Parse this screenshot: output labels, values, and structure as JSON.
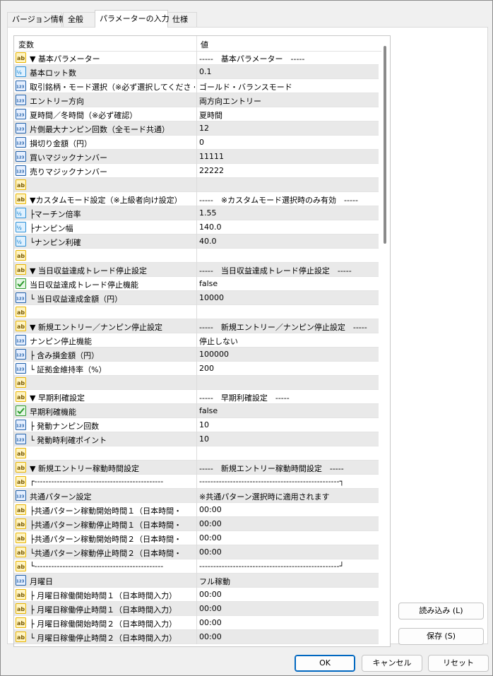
{
  "tabs": [
    {
      "label": "バージョン情報"
    },
    {
      "label": "全般"
    },
    {
      "label": "パラメーターの入力"
    },
    {
      "label": "仕様"
    }
  ],
  "grid": {
    "col_name": "変数",
    "col_value": "値",
    "rows": [
      {
        "icon": "ab",
        "name": "▼ 基本パラメーター",
        "value": "-----　基本パラメーター　-----"
      },
      {
        "icon": "v2",
        "name": "基本ロット数",
        "value": "0.1"
      },
      {
        "icon": "123",
        "name": "取引銘柄・モード選択（※必ず選択してくださ・",
        "value": "ゴールド・バランスモード"
      },
      {
        "icon": "123",
        "name": "エントリー方向",
        "value": "両方向エントリー"
      },
      {
        "icon": "123",
        "name": "夏時間／冬時間（※必ず確認）",
        "value": "夏時間"
      },
      {
        "icon": "123",
        "name": "片側最大ナンピン回数（全モード共通）",
        "value": "12"
      },
      {
        "icon": "123",
        "name": "損切り金額（円）",
        "value": "0"
      },
      {
        "icon": "123",
        "name": "買いマジックナンバー",
        "value": "11111"
      },
      {
        "icon": "123",
        "name": "売りマジックナンバー",
        "value": "22222"
      },
      {
        "icon": "ab",
        "name": "",
        "value": ""
      },
      {
        "icon": "ab",
        "name": "▼カスタムモード設定（※上級者向け設定）",
        "value": "-----　※カスタムモード選択時のみ有効　-----"
      },
      {
        "icon": "v2",
        "name": "├マーチン倍率",
        "value": "1.55"
      },
      {
        "icon": "v2",
        "name": "├ナンピン幅",
        "value": "140.0"
      },
      {
        "icon": "v2",
        "name": "└ナンピン利確",
        "value": "40.0"
      },
      {
        "icon": "ab",
        "name": "",
        "value": ""
      },
      {
        "icon": "ab",
        "name": "▼ 当日収益達成トレード停止設定",
        "value": "-----　当日収益達成トレード停止設定　-----"
      },
      {
        "icon": "bool",
        "name": "当日収益達成トレード停止機能",
        "value": "false"
      },
      {
        "icon": "123",
        "name": "└ 当日収益達成金額（円）",
        "value": "10000"
      },
      {
        "icon": "ab",
        "name": "",
        "value": ""
      },
      {
        "icon": "ab",
        "name": "▼ 新規エントリー／ナンピン停止設定",
        "value": "-----　新規エントリー／ナンピン停止設定　-----"
      },
      {
        "icon": "123",
        "name": "ナンピン停止機能",
        "value": "停止しない"
      },
      {
        "icon": "123",
        "name": "├ 含み損金額（円）",
        "value": "100000"
      },
      {
        "icon": "123",
        "name": "└ 証拠金維持率（%）",
        "value": "200"
      },
      {
        "icon": "ab",
        "name": "",
        "value": ""
      },
      {
        "icon": "ab",
        "name": "▼ 早期利確設定",
        "value": "-----　早期利確設定　-----"
      },
      {
        "icon": "bool",
        "name": "早期利確機能",
        "value": "false"
      },
      {
        "icon": "123",
        "name": "├ 発動ナンピン回数",
        "value": "10"
      },
      {
        "icon": "123",
        "name": "└ 発動時利確ポイント",
        "value": "10"
      },
      {
        "icon": "ab",
        "name": "",
        "value": ""
      },
      {
        "icon": "ab",
        "name": "▼ 新規エントリー稼動時間設定",
        "value": "-----　新規エントリー稼動時間設定　-----"
      },
      {
        "icon": "ab",
        "name": "┌----------------------------------------------",
        "value": "--------------------------------------------------┐"
      },
      {
        "icon": "123",
        "name": "共通パターン設定",
        "value": "※共通パターン選択時に適用されます"
      },
      {
        "icon": "ab",
        "name": "├共通パターン稼動開始時間１（日本時間・",
        "value": "00:00"
      },
      {
        "icon": "ab",
        "name": "├共通パターン稼動停止時間１（日本時間・",
        "value": "00:00"
      },
      {
        "icon": "ab",
        "name": "├共通パターン稼動開始時間２（日本時間・",
        "value": "00:00"
      },
      {
        "icon": "ab",
        "name": "└共通パターン稼動停止時間２（日本時間・",
        "value": "00:00"
      },
      {
        "icon": "ab",
        "name": "└----------------------------------------------",
        "value": "--------------------------------------------------┘"
      },
      {
        "icon": "123",
        "name": "月曜日",
        "value": "フル稼動"
      },
      {
        "icon": "ab",
        "name": "├ 月曜日稼働開始時間１（日本時間入力）",
        "value": "00:00"
      },
      {
        "icon": "ab",
        "name": "├ 月曜日稼働停止時間１（日本時間入力）",
        "value": "00:00"
      },
      {
        "icon": "ab",
        "name": "├ 月曜日稼働開始時間２（日本時間入力）",
        "value": "00:00"
      },
      {
        "icon": "ab",
        "name": "└ 月曜日稼働停止時間２（日本時間入力）",
        "value": "00:00"
      }
    ]
  },
  "side_buttons": {
    "load": "読み込み (L)",
    "save": "保存 (S)"
  },
  "footer_buttons": {
    "ok": "OK",
    "cancel": "キャンセル",
    "reset": "リセット"
  },
  "icon_colors": {
    "ab": "#e8b400",
    "v2": "#2a8fd6",
    "123": "#1f5fa8",
    "bool": "#2e9a2e"
  }
}
